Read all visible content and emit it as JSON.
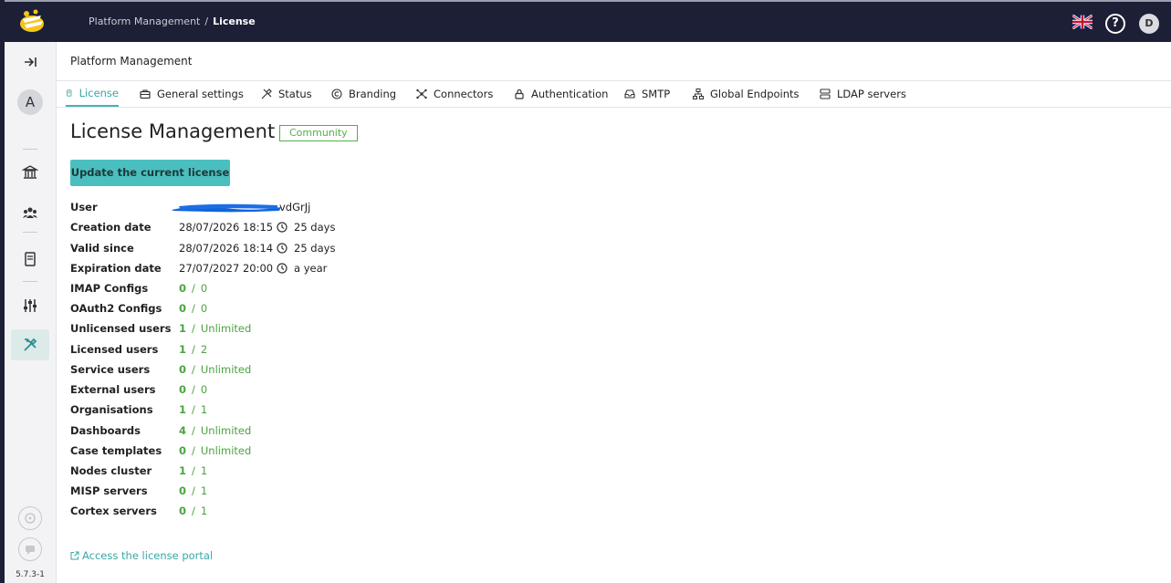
{
  "header": {
    "breadcrumb_parent": "Platform Management",
    "breadcrumb_separator": "/",
    "breadcrumb_current": "License",
    "user_initial": "D",
    "help_symbol": "?"
  },
  "sidebar": {
    "user_initial": "A",
    "version": "5.7.3-1",
    "items": [
      "expand-icon",
      "bank-icon",
      "team-icon",
      "book-icon",
      "sliders-icon",
      "tools-icon"
    ]
  },
  "page": {
    "header_title": "Platform Management",
    "title": "License Management",
    "badge": "Community",
    "update_button": "Update the current license",
    "portal_link": "Access the license portal"
  },
  "tabs": [
    {
      "label": "License",
      "icon": "license-icon",
      "active": true
    },
    {
      "label": "General settings",
      "icon": "briefcase-icon"
    },
    {
      "label": "Status",
      "icon": "tools-icon"
    },
    {
      "label": "Branding",
      "icon": "copyright-icon"
    },
    {
      "label": "Connectors",
      "icon": "connectors-icon"
    },
    {
      "label": "Authentication",
      "icon": "lock-icon"
    },
    {
      "label": "SMTP",
      "icon": "inbox-icon"
    },
    {
      "label": "Global Endpoints",
      "icon": "network-icon"
    },
    {
      "label": "LDAP servers",
      "icon": "server-icon"
    }
  ],
  "license": {
    "user": {
      "label": "User",
      "value_suffix": "vdGrJj"
    },
    "dates": [
      {
        "label": "Creation date",
        "value": "28/07/2026 18:15",
        "duration": "25 days"
      },
      {
        "label": "Valid since",
        "value": "28/07/2026 18:14",
        "duration": "25 days"
      },
      {
        "label": "Expiration date",
        "value": "27/07/2027 20:00",
        "duration": "a year"
      }
    ],
    "limits": [
      {
        "label": "IMAP Configs",
        "used": "0",
        "max": "0"
      },
      {
        "label": "OAuth2 Configs",
        "used": "0",
        "max": "0"
      },
      {
        "label": "Unlicensed users",
        "used": "1",
        "max": "Unlimited"
      },
      {
        "label": "Licensed users",
        "used": "1",
        "max": "2"
      },
      {
        "label": "Service users",
        "used": "0",
        "max": "Unlimited"
      },
      {
        "label": "External users",
        "used": "0",
        "max": "0"
      },
      {
        "label": "Organisations",
        "used": "1",
        "max": "1"
      },
      {
        "label": "Dashboards",
        "used": "4",
        "max": "Unlimited"
      },
      {
        "label": "Case templates",
        "used": "0",
        "max": "Unlimited"
      },
      {
        "label": "Nodes cluster",
        "used": "1",
        "max": "1"
      },
      {
        "label": "MISP servers",
        "used": "0",
        "max": "1"
      },
      {
        "label": "Cortex servers",
        "used": "0",
        "max": "1"
      }
    ],
    "slash": "/"
  },
  "colors": {
    "accent": "#4bbfbf",
    "topbar": "#1c1f36",
    "count_green": "#4aa33f"
  }
}
